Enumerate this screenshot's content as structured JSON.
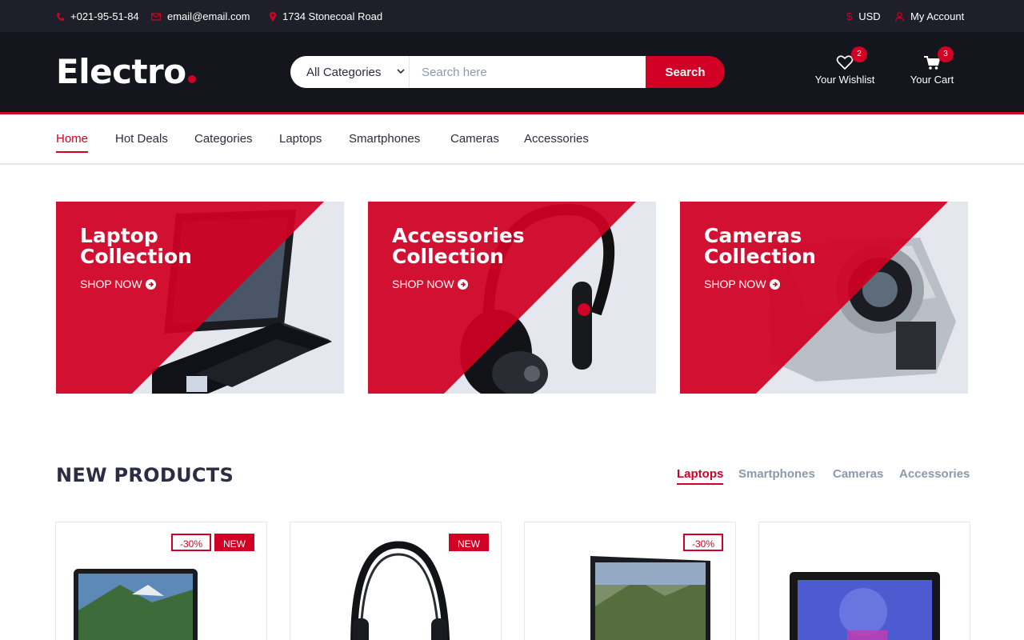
{
  "topbar": {
    "phone": "+021-95-51-84",
    "email": "email@email.com",
    "address": "1734 Stonecoal Road",
    "currency": "USD",
    "account": "My Account"
  },
  "header": {
    "logo": "Electro",
    "search": {
      "category": "All Categories",
      "placeholder": "Search here",
      "button": "Search"
    },
    "wishlist": {
      "label": "Your Wishlist",
      "count": "2"
    },
    "cart": {
      "label": "Your Cart",
      "count": "3"
    }
  },
  "nav": {
    "items": [
      "Home",
      "Hot Deals",
      "Categories",
      "Laptops",
      "Smartphones",
      "Cameras",
      "Accessories"
    ],
    "active": "Home"
  },
  "banners": [
    {
      "title_line1": "Laptop",
      "title_line2": "Collection",
      "cta": "SHOP NOW"
    },
    {
      "title_line1": "Accessories",
      "title_line2": "Collection",
      "cta": "SHOP NOW"
    },
    {
      "title_line1": "Cameras",
      "title_line2": "Collection",
      "cta": "SHOP NOW"
    }
  ],
  "new_products": {
    "title": "NEW PRODUCTS",
    "tabs": [
      "Laptops",
      "Smartphones",
      "Cameras",
      "Accessories"
    ],
    "active_tab": "Laptops",
    "cards": [
      {
        "sale": "-30%",
        "new": "NEW"
      },
      {
        "new": "NEW"
      },
      {
        "sale": "-30%"
      },
      {}
    ]
  },
  "colors": {
    "primary": "#d10024",
    "dark": "#15161d",
    "topbar": "#1e1f29",
    "text": "#2b2d42",
    "muted": "#8d99ae",
    "border": "#e4e7ed"
  }
}
